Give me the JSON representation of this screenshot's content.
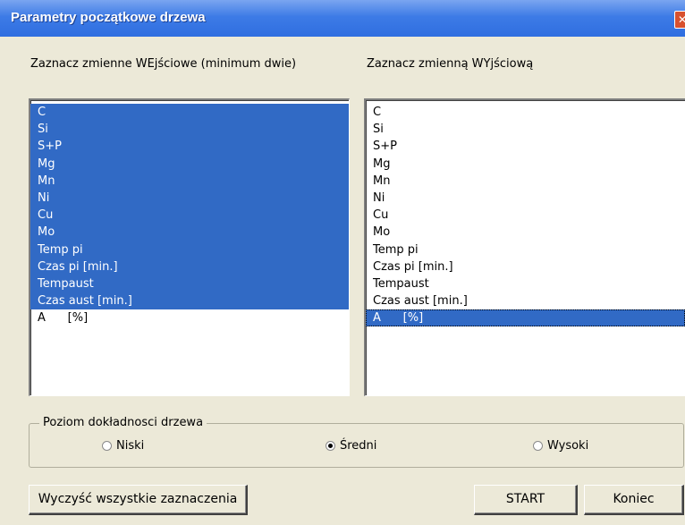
{
  "window": {
    "title": "Parametry początkowe drzewa",
    "close_glyph": "✕"
  },
  "input_list": {
    "label": "Zaznacz zmienne WEjściowe (minimum dwie)",
    "items": [
      {
        "label": "C",
        "selected": true
      },
      {
        "label": "Si",
        "selected": true
      },
      {
        "label": "S+P",
        "selected": true
      },
      {
        "label": "Mg",
        "selected": true
      },
      {
        "label": "Mn",
        "selected": true
      },
      {
        "label": "Ni",
        "selected": true
      },
      {
        "label": "Cu",
        "selected": true
      },
      {
        "label": "Mo",
        "selected": true
      },
      {
        "label": "Temp pi",
        "selected": true
      },
      {
        "label": "Czas pi [min.]",
        "selected": true
      },
      {
        "label": "Tempaust",
        "selected": true
      },
      {
        "label": "Czas aust [min.]",
        "selected": true
      },
      {
        "label": "A      [%]",
        "selected": false
      }
    ]
  },
  "output_list": {
    "label": "Zaznacz zmienną WYjściową",
    "items": [
      {
        "label": "C",
        "selected": false
      },
      {
        "label": "Si",
        "selected": false
      },
      {
        "label": "S+P",
        "selected": false
      },
      {
        "label": "Mg",
        "selected": false
      },
      {
        "label": "Mn",
        "selected": false
      },
      {
        "label": "Ni",
        "selected": false
      },
      {
        "label": "Cu",
        "selected": false
      },
      {
        "label": "Mo",
        "selected": false
      },
      {
        "label": "Temp pi",
        "selected": false
      },
      {
        "label": "Czas pi [min.]",
        "selected": false
      },
      {
        "label": "Tempaust",
        "selected": false
      },
      {
        "label": "Czas aust [min.]",
        "selected": false
      },
      {
        "label": "A      [%]",
        "selected": true
      }
    ]
  },
  "accuracy": {
    "legend": "Poziom dokładnosci drzewa",
    "options": [
      {
        "label": "Niski",
        "checked": false
      },
      {
        "label": "Średni",
        "checked": true
      },
      {
        "label": "Wysoki",
        "checked": false
      }
    ]
  },
  "buttons": {
    "clear": "Wyczyść wszystkie zaznaczenia",
    "start": "START",
    "end": "Koniec"
  },
  "colors": {
    "selection": "#316AC5",
    "window_bg": "#ECE9D8",
    "titlebar": "#2f6ee0"
  }
}
